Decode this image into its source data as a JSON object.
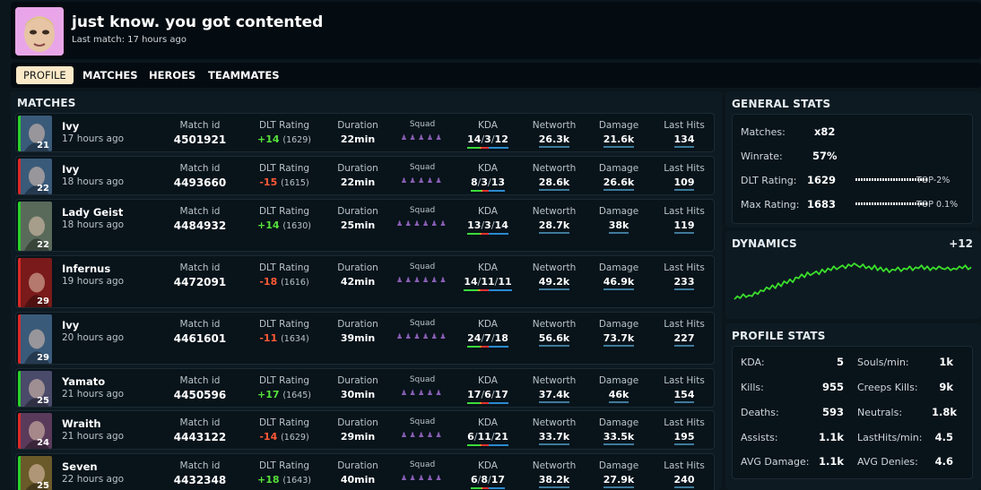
{
  "profile": {
    "name": "just know. you got contented",
    "last_match": "Last match: 17 hours ago",
    "avatar_color": "#e8a6e8"
  },
  "tabs": [
    "PROFILE",
    "MATCHES",
    "HEROES",
    "TEAMMATES"
  ],
  "active_tab": "PROFILE",
  "matches": {
    "title": "MATCHES",
    "labels": {
      "match_id": "Match id",
      "rating": "DLT Rating",
      "duration": "Duration",
      "squad": "Squad",
      "kda": "KDA",
      "networth": "Networth",
      "damage": "Damage",
      "last_hits": "Last Hits"
    },
    "rows": [
      {
        "hero": "Ivy",
        "time": "17 hours ago",
        "level": "21",
        "result": "win",
        "match_id": "4501921",
        "rating_change": "+14",
        "rating": "(1629)",
        "duration": "22min",
        "squad_count": 5,
        "kills": "14",
        "deaths": "3",
        "assists": "12",
        "networth": "26.3k",
        "damage": "21.6k",
        "last_hits": "134",
        "hero_color": "#3a5a7a"
      },
      {
        "hero": "Ivy",
        "time": "18 hours ago",
        "level": "22",
        "result": "loss",
        "match_id": "4493660",
        "rating_change": "-15",
        "rating": "(1615)",
        "duration": "22min",
        "squad_count": 5,
        "kills": "8",
        "deaths": "3",
        "assists": "13",
        "networth": "28.6k",
        "damage": "26.6k",
        "last_hits": "109",
        "hero_color": "#3a5a7a"
      },
      {
        "hero": "Lady Geist",
        "time": "18 hours ago",
        "level": "22",
        "result": "win",
        "match_id": "4484932",
        "rating_change": "+14",
        "rating": "(1630)",
        "duration": "25min",
        "squad_count": 6,
        "kills": "13",
        "deaths": "3",
        "assists": "14",
        "networth": "28.7k",
        "damage": "38k",
        "last_hits": "119",
        "hero_color": "#5a6a5a"
      },
      {
        "hero": "Infernus",
        "time": "19 hours ago",
        "level": "29",
        "result": "loss",
        "match_id": "4472091",
        "rating_change": "-18",
        "rating": "(1616)",
        "duration": "42min",
        "squad_count": 6,
        "kills": "14",
        "deaths": "11",
        "assists": "11",
        "networth": "49.2k",
        "damage": "46.9k",
        "last_hits": "233",
        "hero_color": "#7a1a1a"
      },
      {
        "hero": "Ivy",
        "time": "20 hours ago",
        "level": "29",
        "result": "loss",
        "match_id": "4461601",
        "rating_change": "-11",
        "rating": "(1634)",
        "duration": "39min",
        "squad_count": 6,
        "kills": "24",
        "deaths": "7",
        "assists": "18",
        "networth": "56.6k",
        "damage": "73.7k",
        "last_hits": "227",
        "hero_color": "#3a5a7a"
      },
      {
        "hero": "Yamato",
        "time": "21 hours ago",
        "level": "25",
        "result": "win",
        "match_id": "4450596",
        "rating_change": "+17",
        "rating": "(1645)",
        "duration": "30min",
        "squad_count": 5,
        "kills": "17",
        "deaths": "6",
        "assists": "17",
        "networth": "37.4k",
        "damage": "46k",
        "last_hits": "154",
        "hero_color": "#4a4a6a"
      },
      {
        "hero": "Wraith",
        "time": "21 hours ago",
        "level": "24",
        "result": "loss",
        "match_id": "4443122",
        "rating_change": "-14",
        "rating": "(1629)",
        "duration": "29min",
        "squad_count": 5,
        "kills": "6",
        "deaths": "11",
        "assists": "21",
        "networth": "33.7k",
        "damage": "33.5k",
        "last_hits": "195",
        "hero_color": "#5a3a5a"
      },
      {
        "hero": "Seven",
        "time": "22 hours ago",
        "level": "25",
        "result": "win",
        "match_id": "4432348",
        "rating_change": "+18",
        "rating": "(1643)",
        "duration": "40min",
        "squad_count": 5,
        "kills": "6",
        "deaths": "8",
        "assists": "17",
        "networth": "38.2k",
        "damage": "27.9k",
        "last_hits": "240",
        "hero_color": "#6a5a2a"
      }
    ]
  },
  "general_stats": {
    "title": "GENERAL STATS",
    "matches_label": "Matches:",
    "matches_value": "x82",
    "winrate_label": "Winrate:",
    "winrate_value": "57%",
    "dlt_label": "DLT Rating:",
    "dlt_value": "1629",
    "dlt_top": "TOP-2%",
    "max_label": "Max Rating:",
    "max_value": "1683",
    "max_top": "TOP 0.1%"
  },
  "dynamics": {
    "title": "DYNAMICS",
    "change": "+12",
    "line_color": "#3ae02a",
    "values": [
      0,
      3,
      1,
      5,
      2,
      4,
      3,
      7,
      5,
      9,
      8,
      12,
      10,
      14,
      11,
      16,
      13,
      18,
      16,
      20,
      17,
      22,
      21,
      25,
      22,
      27,
      24,
      26,
      28,
      25,
      30,
      27,
      31,
      29,
      33,
      30,
      32,
      34,
      31,
      35,
      33,
      36,
      34,
      32,
      35,
      31,
      33,
      30,
      34,
      29,
      32,
      28,
      31,
      27,
      30,
      29,
      32,
      28,
      31,
      30,
      33,
      29,
      32,
      31,
      34,
      30,
      33,
      29,
      32,
      30,
      33,
      31,
      30,
      32,
      29,
      31,
      30,
      33,
      31,
      34,
      30,
      32
    ]
  },
  "profile_stats": {
    "title": "PROFILE STATS",
    "left": [
      {
        "label": "KDA:",
        "value": "5"
      },
      {
        "label": "Kills:",
        "value": "955"
      },
      {
        "label": "Deaths:",
        "value": "593"
      },
      {
        "label": "Assists:",
        "value": "1.1k"
      },
      {
        "label": "AVG Damage:",
        "value": "1.1k"
      }
    ],
    "right": [
      {
        "label": "Souls/min:",
        "value": "1k"
      },
      {
        "label": "Creeps Kills:",
        "value": "9k"
      },
      {
        "label": "Neutrals:",
        "value": "1.8k"
      },
      {
        "label": "LastHits/min:",
        "value": "4.5"
      },
      {
        "label": "AVG Denies:",
        "value": "4.6"
      }
    ]
  }
}
